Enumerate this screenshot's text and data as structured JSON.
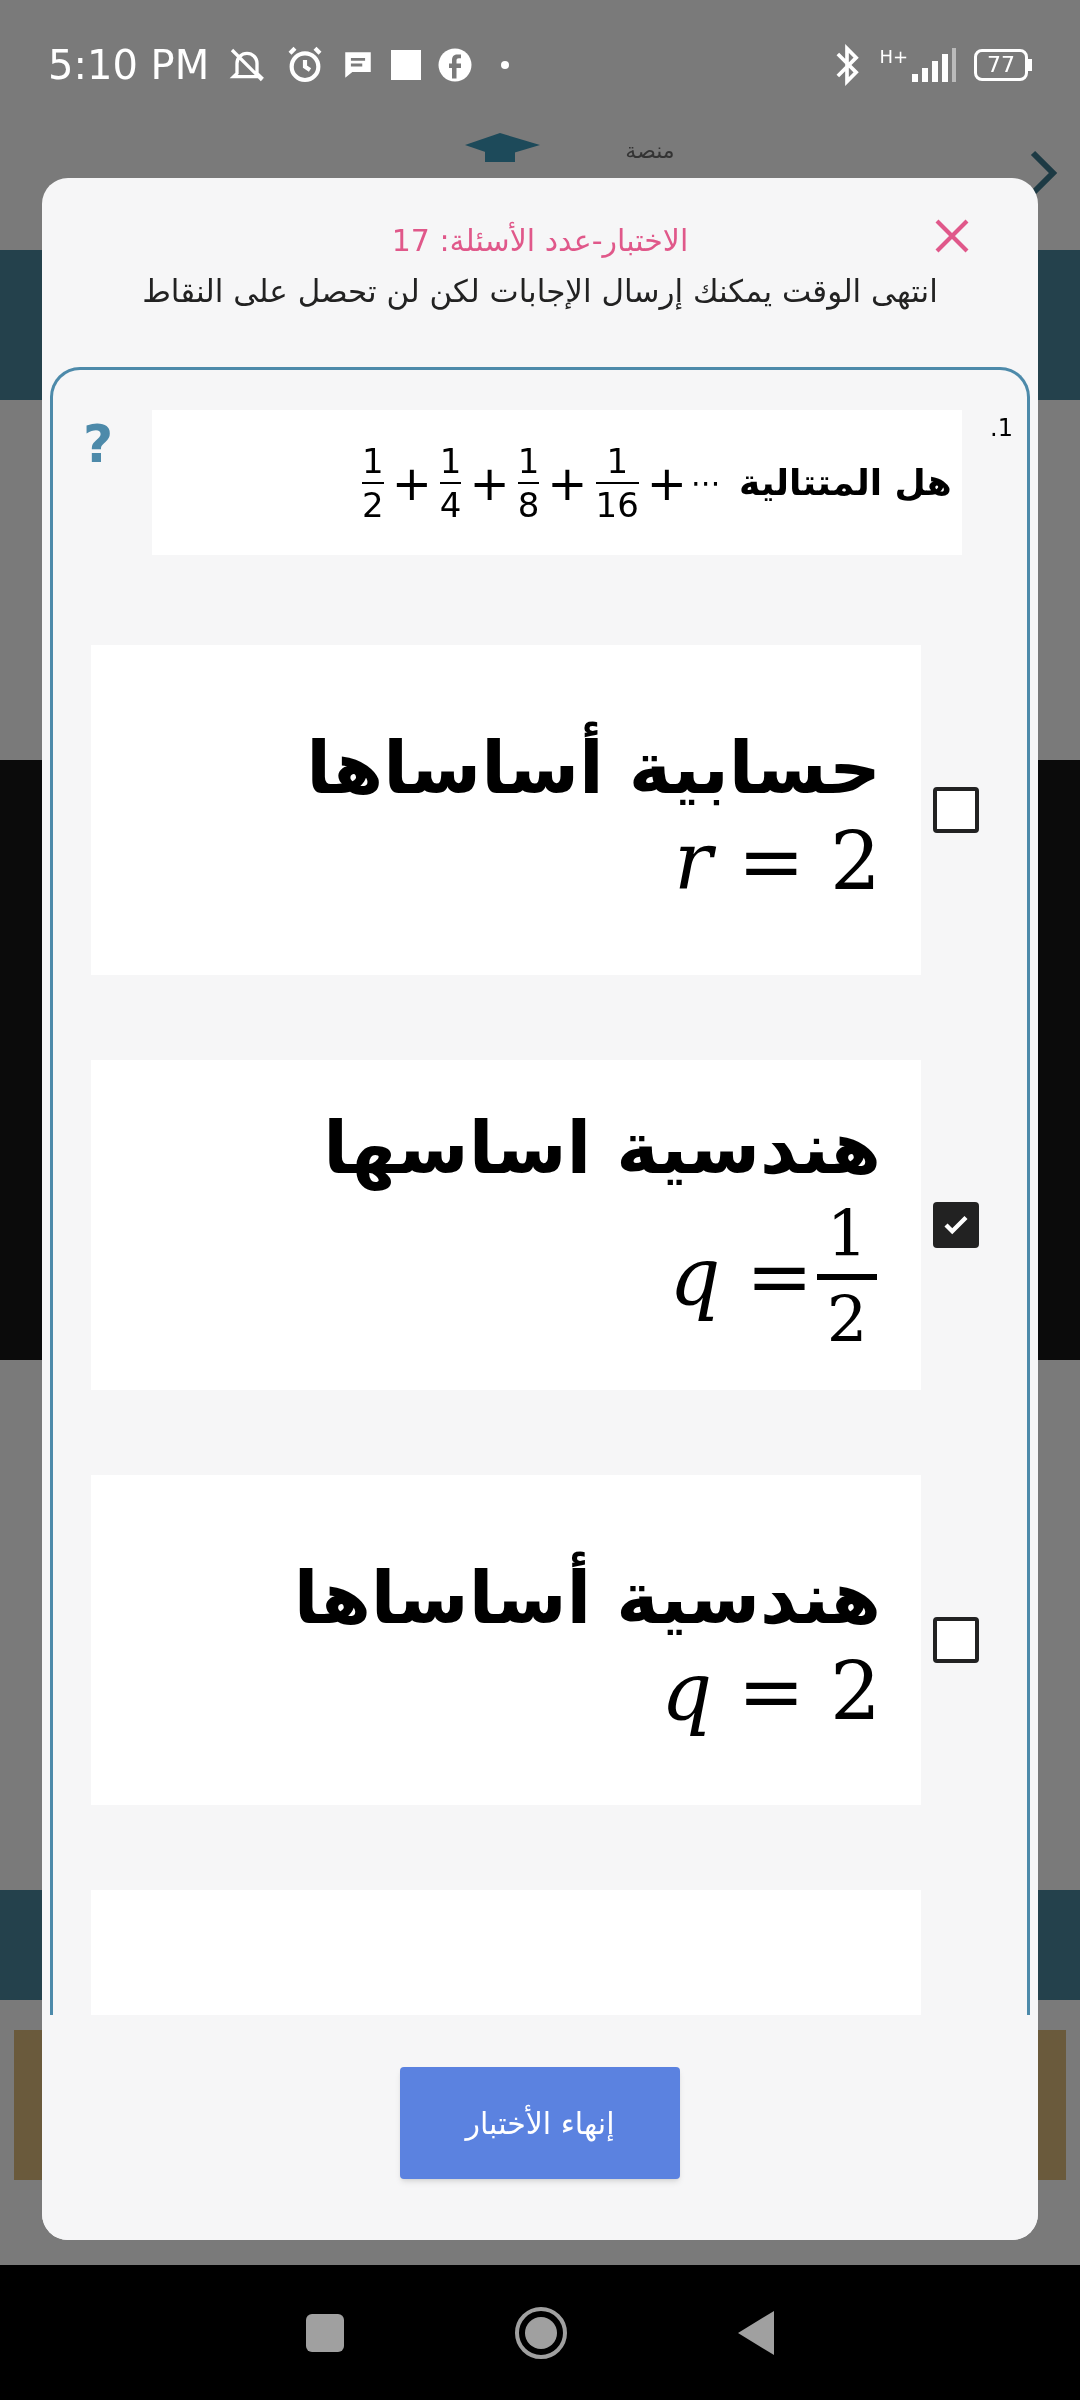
{
  "status_bar": {
    "time": "5:10 PM",
    "network": "H+",
    "battery": "77"
  },
  "background": {
    "brand": "منصة"
  },
  "dialog": {
    "title": "الاختبار-عدد الأسئلة: 17",
    "message": "انتهى الوقت يمكنك إرسال الإجابات لكن لن تحصل على النقاط",
    "question": {
      "number": ".1",
      "help": "?",
      "text": "هل المتتالية",
      "terms": [
        {
          "numerator": "1",
          "denominator": "16",
          "operator": "+"
        },
        {
          "numerator": "1",
          "denominator": "8",
          "operator": "+"
        },
        {
          "numerator": "1",
          "denominator": "4",
          "operator": "+"
        },
        {
          "numerator": "1",
          "denominator": "2",
          "operator": "+"
        }
      ],
      "ellipsis": "⋯"
    },
    "options": [
      {
        "label": "حسابية أساساها",
        "math": "*r* = 2",
        "value": {
          "kind": "none"
        },
        "checked": false
      },
      {
        "label": "هندسية اساسها",
        "math": "*q* =",
        "value": {
          "kind": "fraction",
          "numerator": "1",
          "denominator": "2"
        },
        "checked": true
      },
      {
        "label": "هندسية أساساها",
        "math": "*q* = 2",
        "value": {
          "kind": "none"
        },
        "checked": false
      }
    ],
    "finish_button": "إنهاء الأختبار"
  }
}
